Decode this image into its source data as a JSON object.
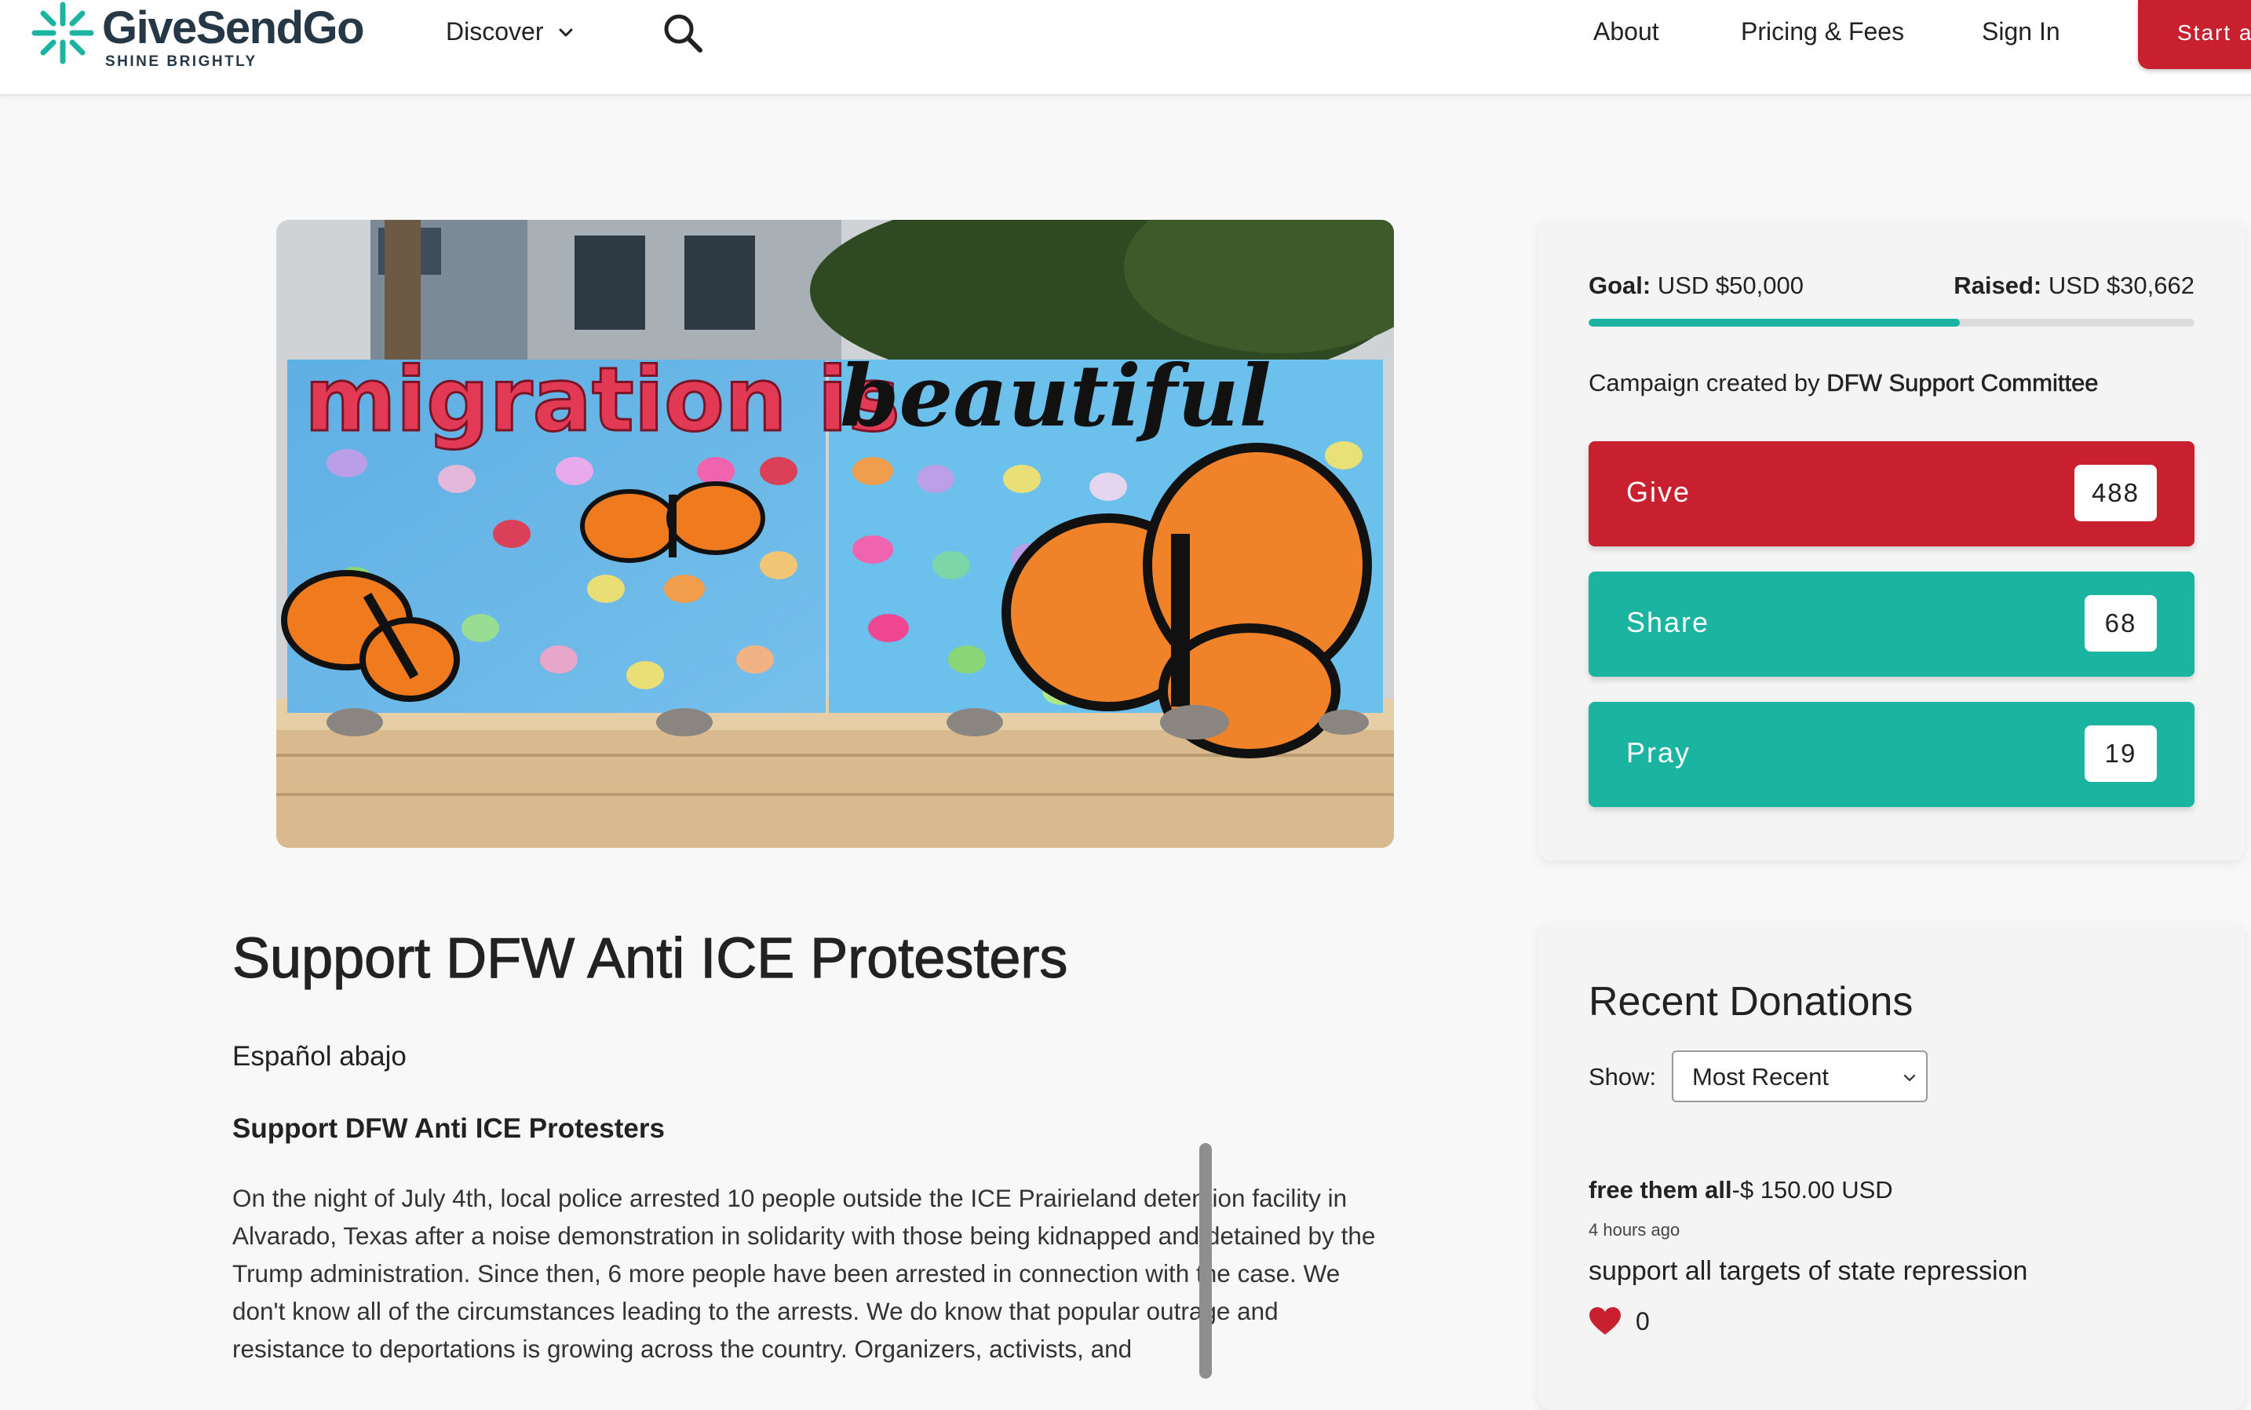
{
  "header": {
    "logo_text": "GiveSendGo",
    "logo_tagline": "SHINE BRIGHTLY",
    "nav_discover": "Discover",
    "nav_about": "About",
    "nav_pricing": "Pricing & Fees",
    "nav_signin": "Sign In",
    "start_label": "Start a"
  },
  "hero": {
    "sign_left": "migration is",
    "sign_right": "beautiful"
  },
  "story": {
    "title": "Support DFW Anti ICE Protesters",
    "lead": "Español abajo",
    "subhead": "Support DFW Anti ICE Protesters",
    "body": "On the night of July 4th, local police arrested 10 people outside the ICE Prairieland detention facility in Alvarado, Texas after a noise demonstration in solidarity with those being kidnapped and detained by the Trump administration. Since then, 6 more people have been arrested in connection with the case.  We don't know all of the circumstances leading to the arrests. We do know that popular outrage and resistance to deportations is growing across the country. Organizers, activists, and"
  },
  "campaign": {
    "goal_label": "Goal:",
    "goal_value": "USD $50,000",
    "raised_label": "Raised:",
    "raised_value": "USD $30,662",
    "progress_fraction": 0.613,
    "creator_prefix": "Campaign created by",
    "creator_name": "DFW Support Committee",
    "give_label": "Give",
    "give_count": "488",
    "share_label": "Share",
    "share_count": "68",
    "pray_label": "Pray",
    "pray_count": "19"
  },
  "donations": {
    "title": "Recent Donations",
    "show_label": "Show:",
    "show_value": "Most Recent",
    "items": [
      {
        "name": "free them all",
        "amount": "-$ 150.00 USD",
        "time": "4 hours ago",
        "message": "support all targets of state repression",
        "likes": "0"
      }
    ]
  },
  "colors": {
    "brand_red": "#c8202f",
    "brand_teal": "#1ab4a0",
    "logo_navy": "#263746"
  },
  "icons": [
    "logo-mark-icon",
    "chevron-down-icon",
    "search-icon",
    "heart-icon"
  ]
}
